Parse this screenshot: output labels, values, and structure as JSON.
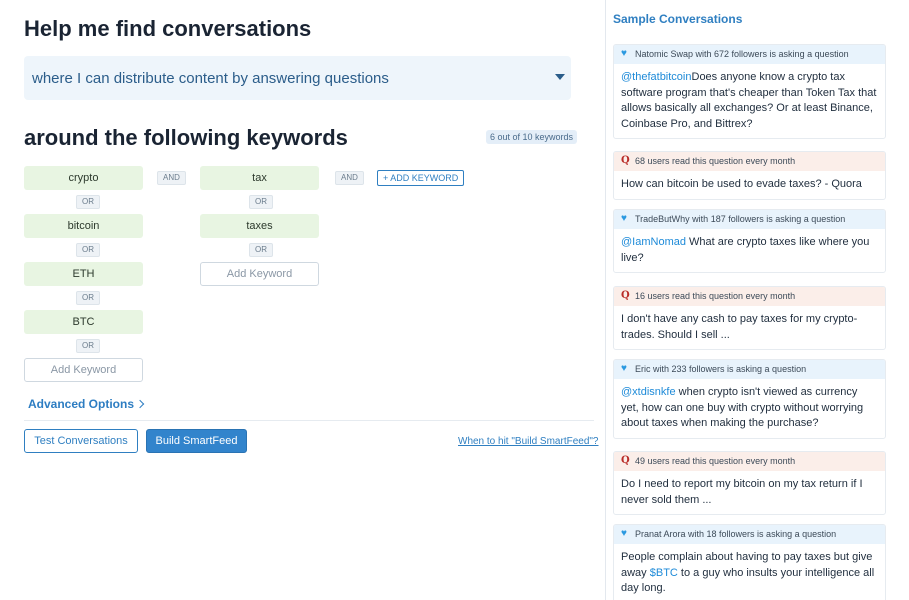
{
  "builder": {
    "title": "Help me find conversations",
    "goal_selected": "where I can distribute content by answering questions",
    "keywords_heading": "around the following keywords",
    "keyword_count": "6 out of 10 keywords",
    "and_label": "AND",
    "or_label": "OR",
    "add_keyword_button": "+ ADD KEYWORD",
    "add_keyword_placeholder": "Add Keyword",
    "groups": [
      {
        "keywords": [
          "crypto",
          "bitcoin",
          "ETH",
          "BTC"
        ]
      },
      {
        "keywords": [
          "tax",
          "taxes"
        ]
      }
    ],
    "advanced_options": "Advanced Options",
    "test_button": "Test Conversations",
    "build_button": "Build SmartFeed",
    "help_link": "When to hit \"Build SmartFeed\"?"
  },
  "sidebar": {
    "title": "Sample Conversations",
    "cards": [
      {
        "source": "twitter",
        "icon": "twitter-icon",
        "header": "Natomic Swap with 672 followers is asking a question",
        "mention": "@thefatbitcoin",
        "text": "Does anyone know a crypto tax software program that's cheaper than Token Tax that allows basically all exchanges? Or at least Binance, Coinbase Pro, and Bittrex?"
      },
      {
        "source": "quora",
        "icon": "quora-icon",
        "header": "68 users read this question every month",
        "mention": "",
        "text": "How can bitcoin be used to evade taxes? - Quora"
      },
      {
        "source": "twitter",
        "icon": "twitter-icon",
        "header": "TradeButWhy with 187 followers is asking a question",
        "mention": "@IamNomad",
        "text": " What are crypto taxes like where you live?"
      },
      {
        "source": "quora",
        "icon": "quora-icon",
        "header": "16 users read this question every month",
        "mention": "",
        "text": "I don't have any cash to pay taxes for my crypto-trades. Should I sell ..."
      },
      {
        "source": "twitter",
        "icon": "twitter-icon",
        "header": "Eric with 233 followers is asking a question",
        "mention": "@xtdisnkfe",
        "text": " when crypto isn't viewed as currency yet, how can one buy with crypto without worrying about taxes when making the purchase?"
      },
      {
        "source": "quora",
        "icon": "quora-icon",
        "header": "49 users read this question every month",
        "mention": "",
        "text": "Do I need to report my bitcoin on my tax return if I never sold them ..."
      },
      {
        "source": "twitter",
        "icon": "twitter-icon",
        "header": "Pranat Arora with 18 followers is asking a question",
        "mention": "",
        "text": "People complain about having to pay taxes but give away ",
        "mention2": "$BTC",
        "text2": " to a guy who insults your intelligence all day long."
      }
    ]
  }
}
